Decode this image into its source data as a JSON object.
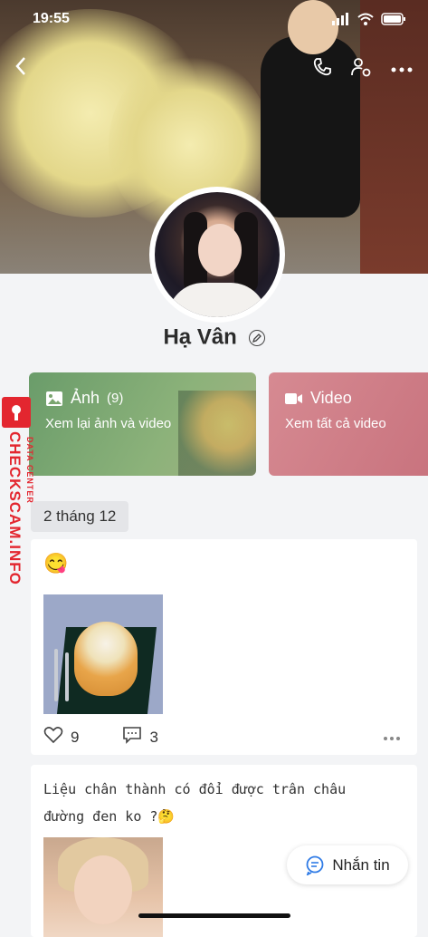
{
  "status_bar": {
    "time": "19:55"
  },
  "profile": {
    "name": "Hạ Vân"
  },
  "cards": [
    {
      "title": "Ảnh",
      "count": "(9)",
      "subtitle": "Xem lại ảnh và video"
    },
    {
      "title": "Video",
      "subtitle": "Xem tất cả video"
    }
  ],
  "feed": {
    "date_label": "2 tháng 12",
    "posts": [
      {
        "text": "😋",
        "likes": "9",
        "comments": "3"
      },
      {
        "text": "Liệu chân thành có đổi được trân châu đường đen ko ?🤔"
      }
    ]
  },
  "chat_button": {
    "label": "Nhắn tin"
  },
  "watermark": {
    "brand": "CHECKSCAM.INFO",
    "sub": "DATA CENTER"
  },
  "colors": {
    "photo_card": "#7aa56f",
    "video_card": "#cf7c86",
    "watermark": "#e3262f"
  }
}
